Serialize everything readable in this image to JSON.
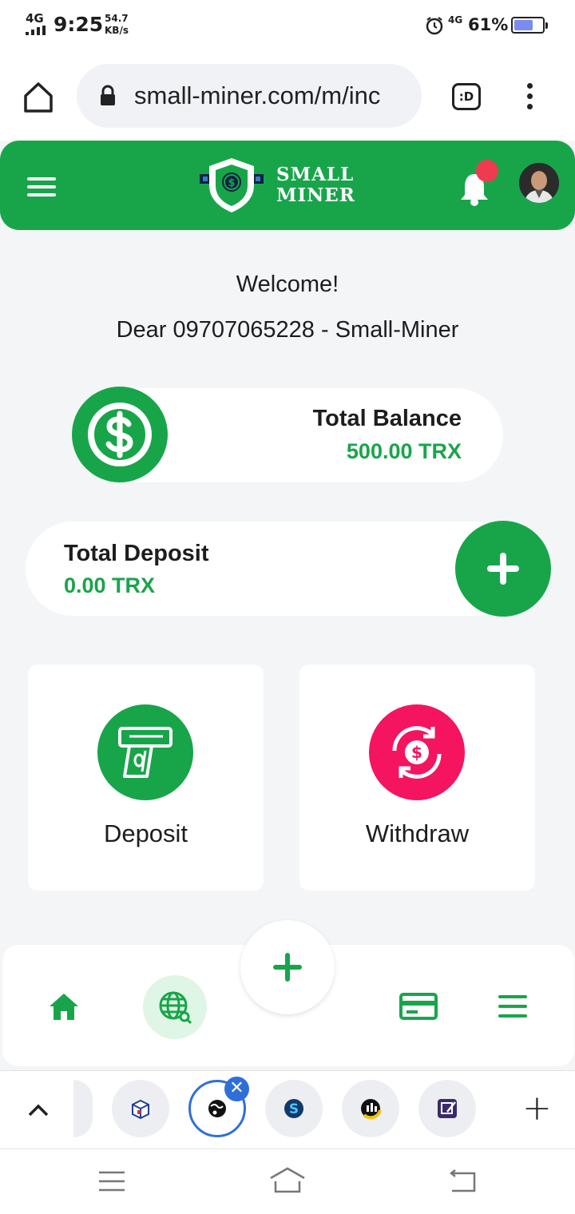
{
  "status_bar": {
    "network": "4G",
    "time": "9:25",
    "speed_value": "54.7",
    "speed_unit": "KB/s",
    "network_right": "4G",
    "battery_percent": "61%"
  },
  "browser": {
    "url": "small-miner.com/m/inc",
    "tabs_label": ":D"
  },
  "app": {
    "logo_line1": "SMALL",
    "logo_line2": "MINER",
    "brand_color": "#18a54a",
    "notification_dot_color": "#ef3a4f"
  },
  "greeting": {
    "welcome": "Welcome!",
    "dear_line": "Dear 09707065228 - Small-Miner"
  },
  "balance": {
    "title": "Total Balance",
    "value": "500.00 TRX"
  },
  "deposit_summary": {
    "title": "Total Deposit",
    "value": "0.00 TRX"
  },
  "actions": [
    {
      "label": "Deposit",
      "icon": "cash-atm-icon",
      "color": "#18a54a"
    },
    {
      "label": "Withdraw",
      "icon": "dollar-cycle-icon",
      "color": "#f5145f"
    }
  ],
  "bottom_nav": {
    "items": [
      "home-icon",
      "globe-icon",
      "add-icon",
      "card-icon",
      "menu-icon"
    ]
  },
  "tab_strip": {
    "plus": "+",
    "close": "✕"
  }
}
